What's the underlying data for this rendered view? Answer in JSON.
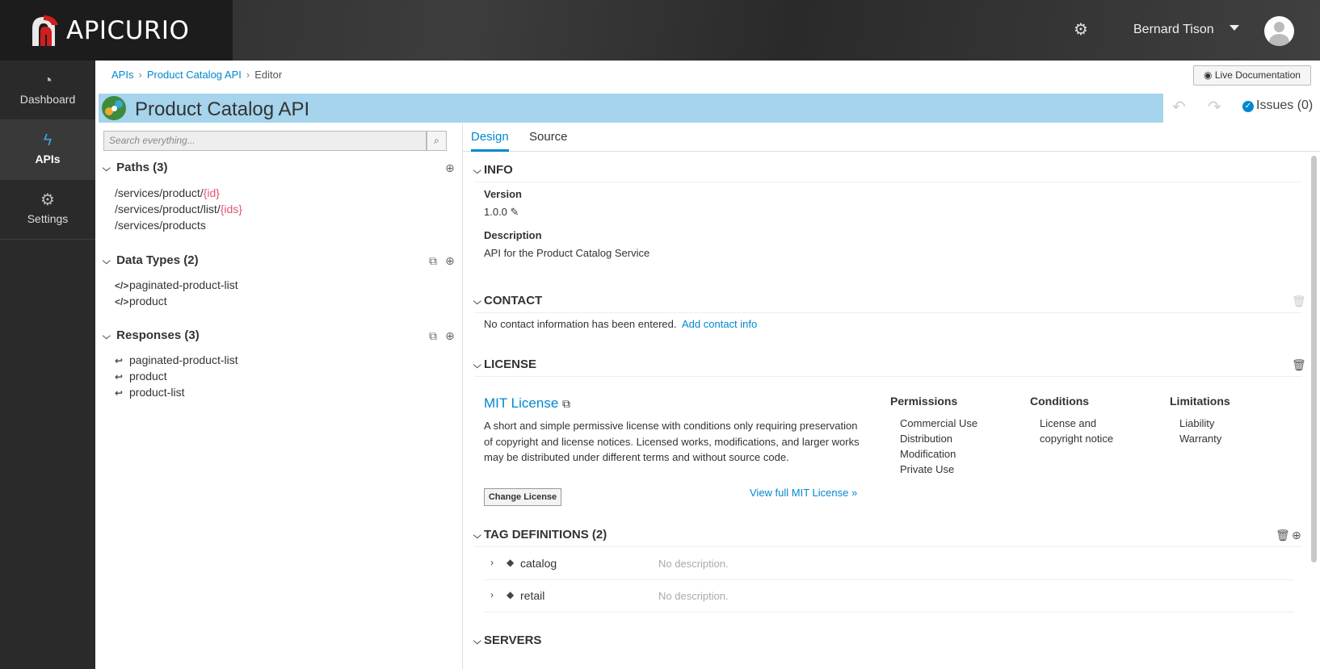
{
  "header": {
    "brand": "APICURIO",
    "user_name": "Bernard Tison"
  },
  "nav": {
    "items": [
      {
        "label": "Dashboard",
        "icon": "dashboard-icon"
      },
      {
        "label": "APIs",
        "icon": "bolt-icon",
        "active": true
      },
      {
        "label": "Settings",
        "icon": "cogs-icon"
      }
    ]
  },
  "breadcrumb": {
    "apis": "APIs",
    "api": "Product Catalog API",
    "current": "Editor",
    "sep": "›"
  },
  "toolbar": {
    "live_doc": "Live Documentation",
    "issues": "Issues (0)"
  },
  "title": "Product Catalog API",
  "search": {
    "placeholder": "Search everything..."
  },
  "tree": {
    "paths_header": "Paths (3)",
    "paths": [
      {
        "base": "/services/product/",
        "param": "{id}"
      },
      {
        "base": "/services/product/list/",
        "param": "{ids}"
      },
      {
        "base": "/services/products",
        "param": ""
      }
    ],
    "datatypes_header": "Data Types (2)",
    "datatypes": [
      "paginated-product-list",
      "product"
    ],
    "responses_header": "Responses (3)",
    "responses": [
      "paginated-product-list",
      "product",
      "product-list"
    ]
  },
  "tabs": {
    "design": "Design",
    "source": "Source"
  },
  "info": {
    "title": "INFO",
    "version_label": "Version",
    "version": "1.0.0",
    "description_label": "Description",
    "description": "API for the Product Catalog Service"
  },
  "contact": {
    "title": "CONTACT",
    "empty": "No contact information has been entered.",
    "add_link": "Add contact info"
  },
  "license": {
    "title": "LICENSE",
    "name": "MIT License",
    "description": "A short and simple permissive license with conditions only requiring preservation of copyright and license notices. Licensed works, modifications, and larger works may be distributed under different terms and without source code.",
    "change_button": "Change License",
    "view_full": "View full MIT License »",
    "permissions_label": "Permissions",
    "permissions": [
      "Commercial Use",
      "Distribution",
      "Modification",
      "Private Use"
    ],
    "conditions_label": "Conditions",
    "conditions_line1": "License and",
    "conditions_line2": "copyright notice",
    "limitations_label": "Limitations",
    "limitations": [
      "Liability",
      "Warranty"
    ]
  },
  "tags": {
    "title": "TAG DEFINITIONS (2)",
    "items": [
      {
        "name": "catalog",
        "description": "No description."
      },
      {
        "name": "retail",
        "description": "No description."
      }
    ]
  },
  "servers": {
    "title": "SERVERS"
  }
}
